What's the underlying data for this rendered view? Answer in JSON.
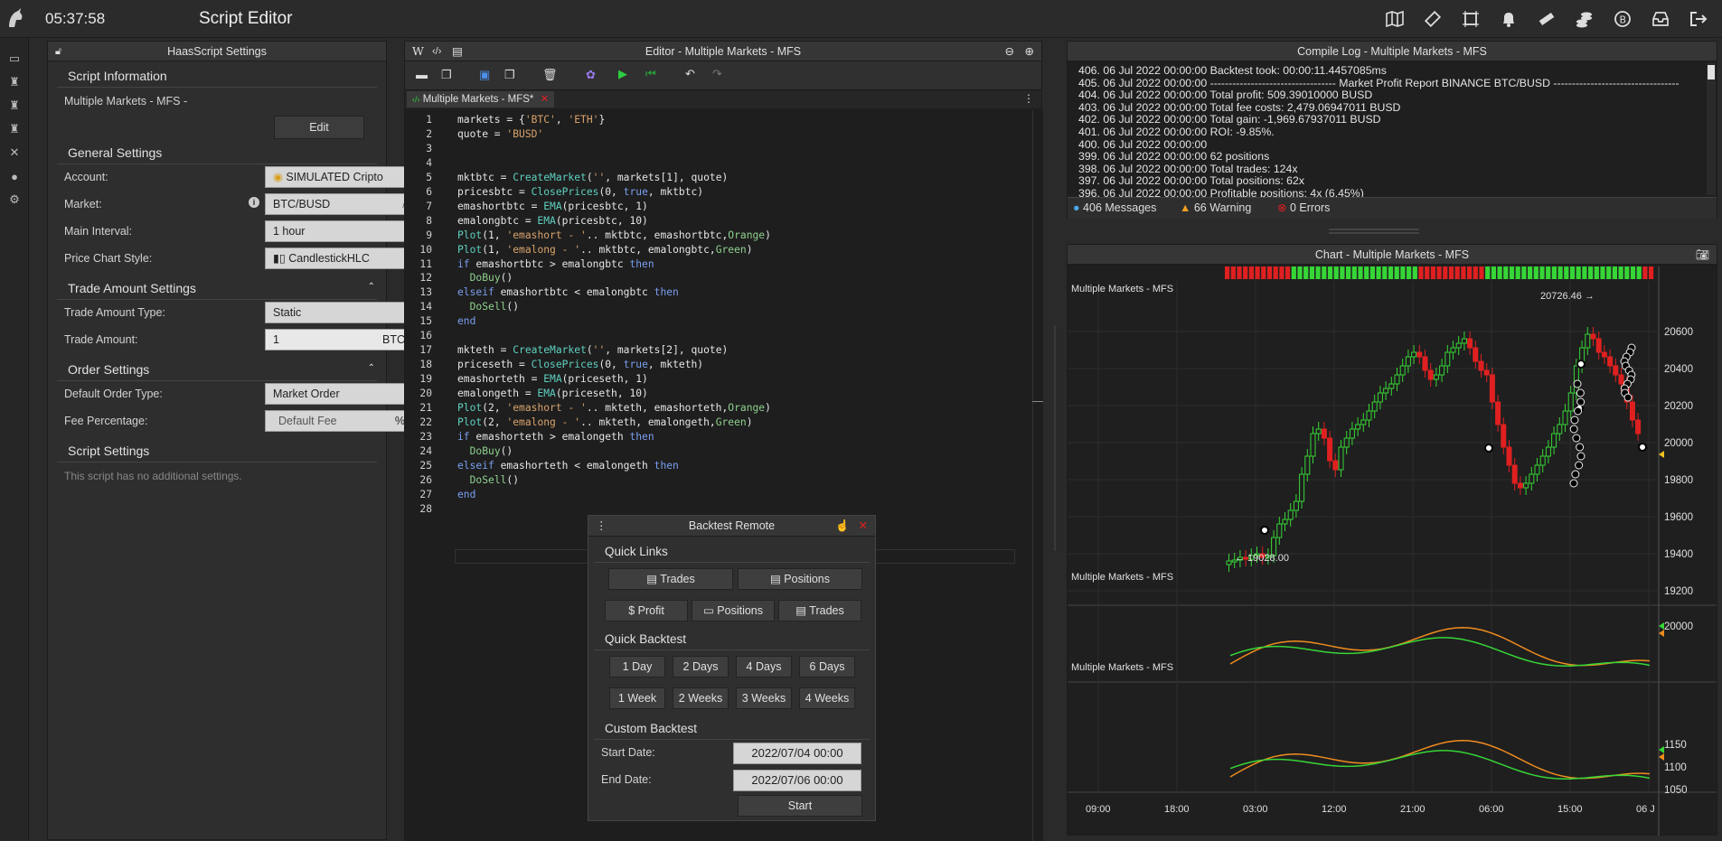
{
  "topbar": {
    "clock": "05:37:58",
    "title": "Script Editor"
  },
  "settings": {
    "header": "HaasScript Settings",
    "script_info": "Script Information",
    "script_name": "Multiple Markets - MFS -",
    "edit": "Edit",
    "general": "General Settings",
    "account_label": "Account:",
    "account_value": "SIMULATED Cripto",
    "market_label": "Market:",
    "market_value": "BTC/BUSD",
    "interval_label": "Main Interval:",
    "interval_value": "1 hour",
    "style_label": "Price Chart Style:",
    "style_value": "CandlestickHLC",
    "trade_amount": "Trade Amount Settings",
    "type_label": "Trade Amount Type:",
    "type_value": "Static",
    "amount_label": "Trade Amount:",
    "amount_value": "1",
    "amount_unit": "BTC",
    "order": "Order Settings",
    "order_type_label": "Default Order Type:",
    "order_type_value": "Market Order",
    "fee_label": "Fee Percentage:",
    "fee_value": "Default Fee",
    "fee_unit": "%",
    "script_settings": "Script Settings",
    "no_settings": "This script has no additional settings."
  },
  "editor": {
    "header": "Editor - Multiple Markets - MFS",
    "tab": "Multiple Markets - MFS*",
    "lines": [
      "markets = {'BTC', 'ETH'}",
      "quote = 'BUSD'",
      "",
      "",
      "mktbtc = CreateMarket('', markets[1], quote)",
      "pricesbtc = ClosePrices(0, true, mktbtc)",
      "emashortbtc = EMA(pricesbtc, 1)",
      "emalongbtc = EMA(pricesbtc, 10)",
      "Plot(1, 'emashort - '.. mktbtc, emashortbtc,Orange)",
      "Plot(1, 'emalong - '.. mktbtc, emalongbtc,Green)",
      "if emashortbtc > emalongbtc then",
      "  DoBuy()",
      "elseif emashortbtc < emalongbtc then",
      "  DoSell()",
      "end",
      "",
      "mkteth = CreateMarket('', markets[2], quote)",
      "priceseth = ClosePrices(0, true, mkteth)",
      "emashorteth = EMA(priceseth, 1)",
      "emalongeth = EMA(priceseth, 10)",
      "Plot(2, 'emashort - '.. mkteth, emashorteth,Orange)",
      "Plot(2, 'emalong - '.. mkteth, emalongeth,Green)",
      "if emashorteth > emalongeth then",
      "  DoBuy()",
      "elseif emashorteth < emalongeth then",
      "  DoSell()",
      "end",
      ""
    ]
  },
  "backtest": {
    "header": "Backtest Remote",
    "quick_links": "Quick Links",
    "trades": "Trades",
    "positions": "Positions",
    "profit": "$ Profit",
    "quick_backtest": "Quick Backtest",
    "periods": [
      "1 Day",
      "2 Days",
      "4 Days",
      "6 Days",
      "1 Week",
      "2 Weeks",
      "3 Weeks",
      "4 Weeks"
    ],
    "custom": "Custom Backtest",
    "start_label": "Start Date:",
    "start_value": "2022/07/04 00:00",
    "end_label": "End Date:",
    "end_value": "2022/07/06 00:00",
    "start": "Start"
  },
  "log": {
    "header": "Compile Log - Multiple Markets - MFS",
    "lines": [
      "406. 06 Jul 2022 00:00:00 Backtest took: 00:00:11.4457085ms",
      "405. 06 Jul 2022 00:00:00 ---------------------------------- Market Profit Report BINANCE BTC/BUSD ----------------------------------",
      "404. 06 Jul 2022 00:00:00 Total profit: 509.39010000 BUSD",
      "403. 06 Jul 2022 00:00:00 Total fee costs: 2,479.06947011 BUSD",
      "402. 06 Jul 2022 00:00:00 Total gain: -1,969.67937011 BUSD",
      "401. 06 Jul 2022 00:00:00 ROI: -9.85%.",
      "400. 06 Jul 2022 00:00:00",
      "399. 06 Jul 2022 00:00:00 62 positions",
      "398. 06 Jul 2022 00:00:00 Total trades: 124x",
      "397. 06 Jul 2022 00:00:00 Total positions: 62x",
      "396. 06 Jul 2022 00:00:00 Profitable positions: 4x (6.45%)"
    ],
    "messages": "406 Messages",
    "warnings": "66 Warning",
    "errors": "0 Errors"
  },
  "chart": {
    "header": "Chart - Multiple Markets - MFS",
    "pane_title": "Multiple Markets - MFS",
    "price_ticks": [
      "20600",
      "20400",
      "20200",
      "20000",
      "19800",
      "19600",
      "19400",
      "19200"
    ],
    "high_label": "20726.46",
    "low_label": "19028.00",
    "pane2_ticks": [
      "20000"
    ],
    "pane3_ticks": [
      "1150",
      "1100",
      "1050"
    ],
    "time_ticks": [
      "09:00",
      "18:00",
      "03:00",
      "12:00",
      "21:00",
      "06:00",
      "15:00",
      "06 J"
    ]
  },
  "chart_data": {
    "type": "line",
    "title": "Multiple Markets - MFS",
    "x": [
      "09:00",
      "18:00",
      "03:00",
      "12:00",
      "21:00",
      "06:00",
      "15:00",
      "06 J"
    ],
    "ylim": [
      19028,
      20726.46
    ],
    "series": []
  },
  "colors": {
    "accent": "#2ecc40",
    "bear": "#e02020",
    "orange": "#f08c1e",
    "green": "#36d636"
  }
}
